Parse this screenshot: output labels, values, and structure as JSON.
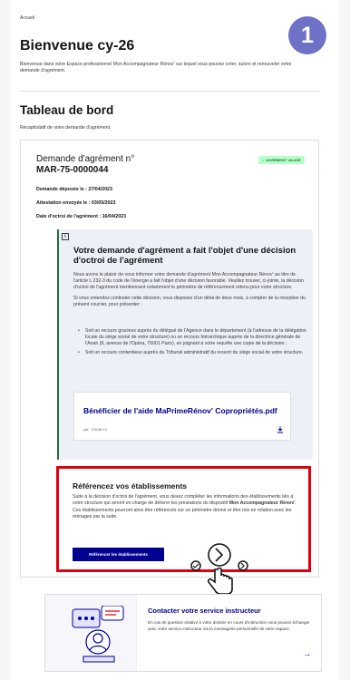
{
  "breadcrumb": "Accueil",
  "step_number": "1",
  "page": {
    "title": "Bienvenue cy-26",
    "intro": "Bienvenue dans votre Espace professionnel Mon Accompagnateur Rénov' sur lequel vous pouvez créer, suivre et renouveler votre demande d'agrément."
  },
  "dashboard": {
    "title": "Tableau de bord",
    "subtitle": "Récapitulatif de votre demande d'agrément."
  },
  "request": {
    "title_line1": "Demande d'agrément n°",
    "title_line2": "MAR-75-0000044",
    "badge": "AGRÉMENT VALIDÉ",
    "filed": "Demande déposée le : 27/04/2023",
    "certificate": "Attestation envoyée le : 03/05/2023",
    "granted": "Date d'octroi de l'agrément : 16/04/2023"
  },
  "decision": {
    "info_icon": "i",
    "title": "Votre demande d'agrément a fait l'objet d'une décision d'octroi de l'agrément",
    "paragraph1": "Nous avons le plaisir de vous informer votre demande d'agrément Mon Accompagnateur Rénov' au titre de l'article L 232-3 du code de l'énergie a fait l'objet d'une décision favorable. Veuillez trouver, ci-jointe, la décision d'octroi de l'agrément mentionnant notamment le périmètre de référencement retenu pour votre structure.",
    "paragraph2": "Si vous entendez contester cette décision, vous disposez d'un délai de deux mois, à compter de la réception du présent courrier, pour présenter :",
    "list": [
      "Soit un recours gracieux auprès du délégué de l'Agence dans le département (à l'adresse de la délégation locale du siège social de votre structure) ou un recours hiérarchique auprès de la directrice générale de l'Anah (8, avenue de l'Opéra, 75001 Paris), en joignant à votre requête une copie de la décision ;",
      "Soit un recours contentieux auprès du Tribunal administratif du ressort du siège social de votre structure."
    ],
    "file_title": "Bénéficier de l'aide MaPrimeRénov' Copropriétés.pdf",
    "file_meta": "pdf - 378,88 Ko",
    "download_icon": "download-icon"
  },
  "establishments": {
    "title": "Référencez vos établissements",
    "text_a": "Suite à la décision d'octroi de l'agrément, vous devez compléter les informations des établissements liés à votre structure qui seront en charge de délivrer les prestations du dispositif ",
    "text_b": "Mon Accompagnateur Rénov'",
    "text_c": ". Ces établissements pourront ainsi être référencés sur un périmètre donné et être mis en relation avec les ménages par la suite.",
    "button": "Référencer les établissements"
  },
  "contact": {
    "title": "Contacter votre service instructeur",
    "text": "En cas de question relative à votre dossier en cours d'instruction vous pouvez échanger avec votre service instructeur via la messagerie personnelle de votre espace.",
    "arrow": "→"
  },
  "colors": {
    "accent": "#000091",
    "highlight": "#e1000f",
    "step": "#6e72c7",
    "badge_bg": "#b8fec9",
    "badge_fg": "#18753c"
  }
}
